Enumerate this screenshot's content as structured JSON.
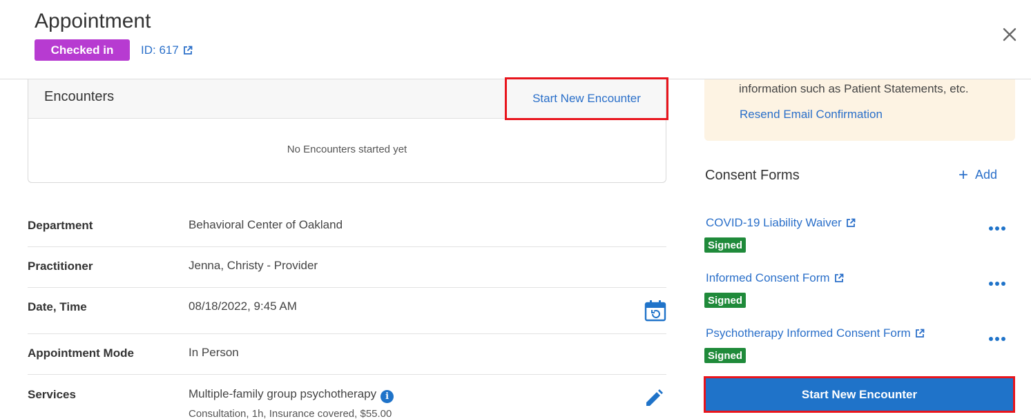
{
  "header": {
    "title": "Appointment",
    "status_badge": "Checked in",
    "id_label": "ID: 617",
    "status_color": "#b73bd1",
    "icons": {
      "close": "close-icon",
      "external": "external-link-icon"
    }
  },
  "encounters": {
    "title": "Encounters",
    "start_label": "Start New Encounter",
    "empty_text": "No Encounters started yet"
  },
  "details": {
    "department": {
      "label": "Department",
      "value": "Behavioral Center of Oakland"
    },
    "practitioner": {
      "label": "Practitioner",
      "value": "Jenna, Christy - Provider"
    },
    "datetime": {
      "label": "Date, Time",
      "value": "08/18/2022, 9:45 AM"
    },
    "mode": {
      "label": "Appointment Mode",
      "value": "In Person"
    },
    "services": {
      "label": "Services",
      "value": "Multiple-family group psychotherapy",
      "sub": "Consultation, 1h, Insurance covered, $55.00"
    }
  },
  "notice": {
    "text": "information such as Patient Statements, etc.",
    "resend_label": "Resend Email Confirmation",
    "background": "#fdf3e3"
  },
  "consent": {
    "title": "Consent Forms",
    "add_label": "Add",
    "forms": [
      {
        "name": "COVID-19 Liability Waiver",
        "status": "Signed"
      },
      {
        "name": "Informed Consent Form",
        "status": "Signed"
      },
      {
        "name": "Psychotherapy Informed Consent Form",
        "status": "Signed"
      }
    ],
    "signed_color": "#1f8a3a"
  },
  "footer": {
    "start_label": "Start New Encounter",
    "accent": "#1f73c9",
    "highlight": "#e8141c"
  }
}
